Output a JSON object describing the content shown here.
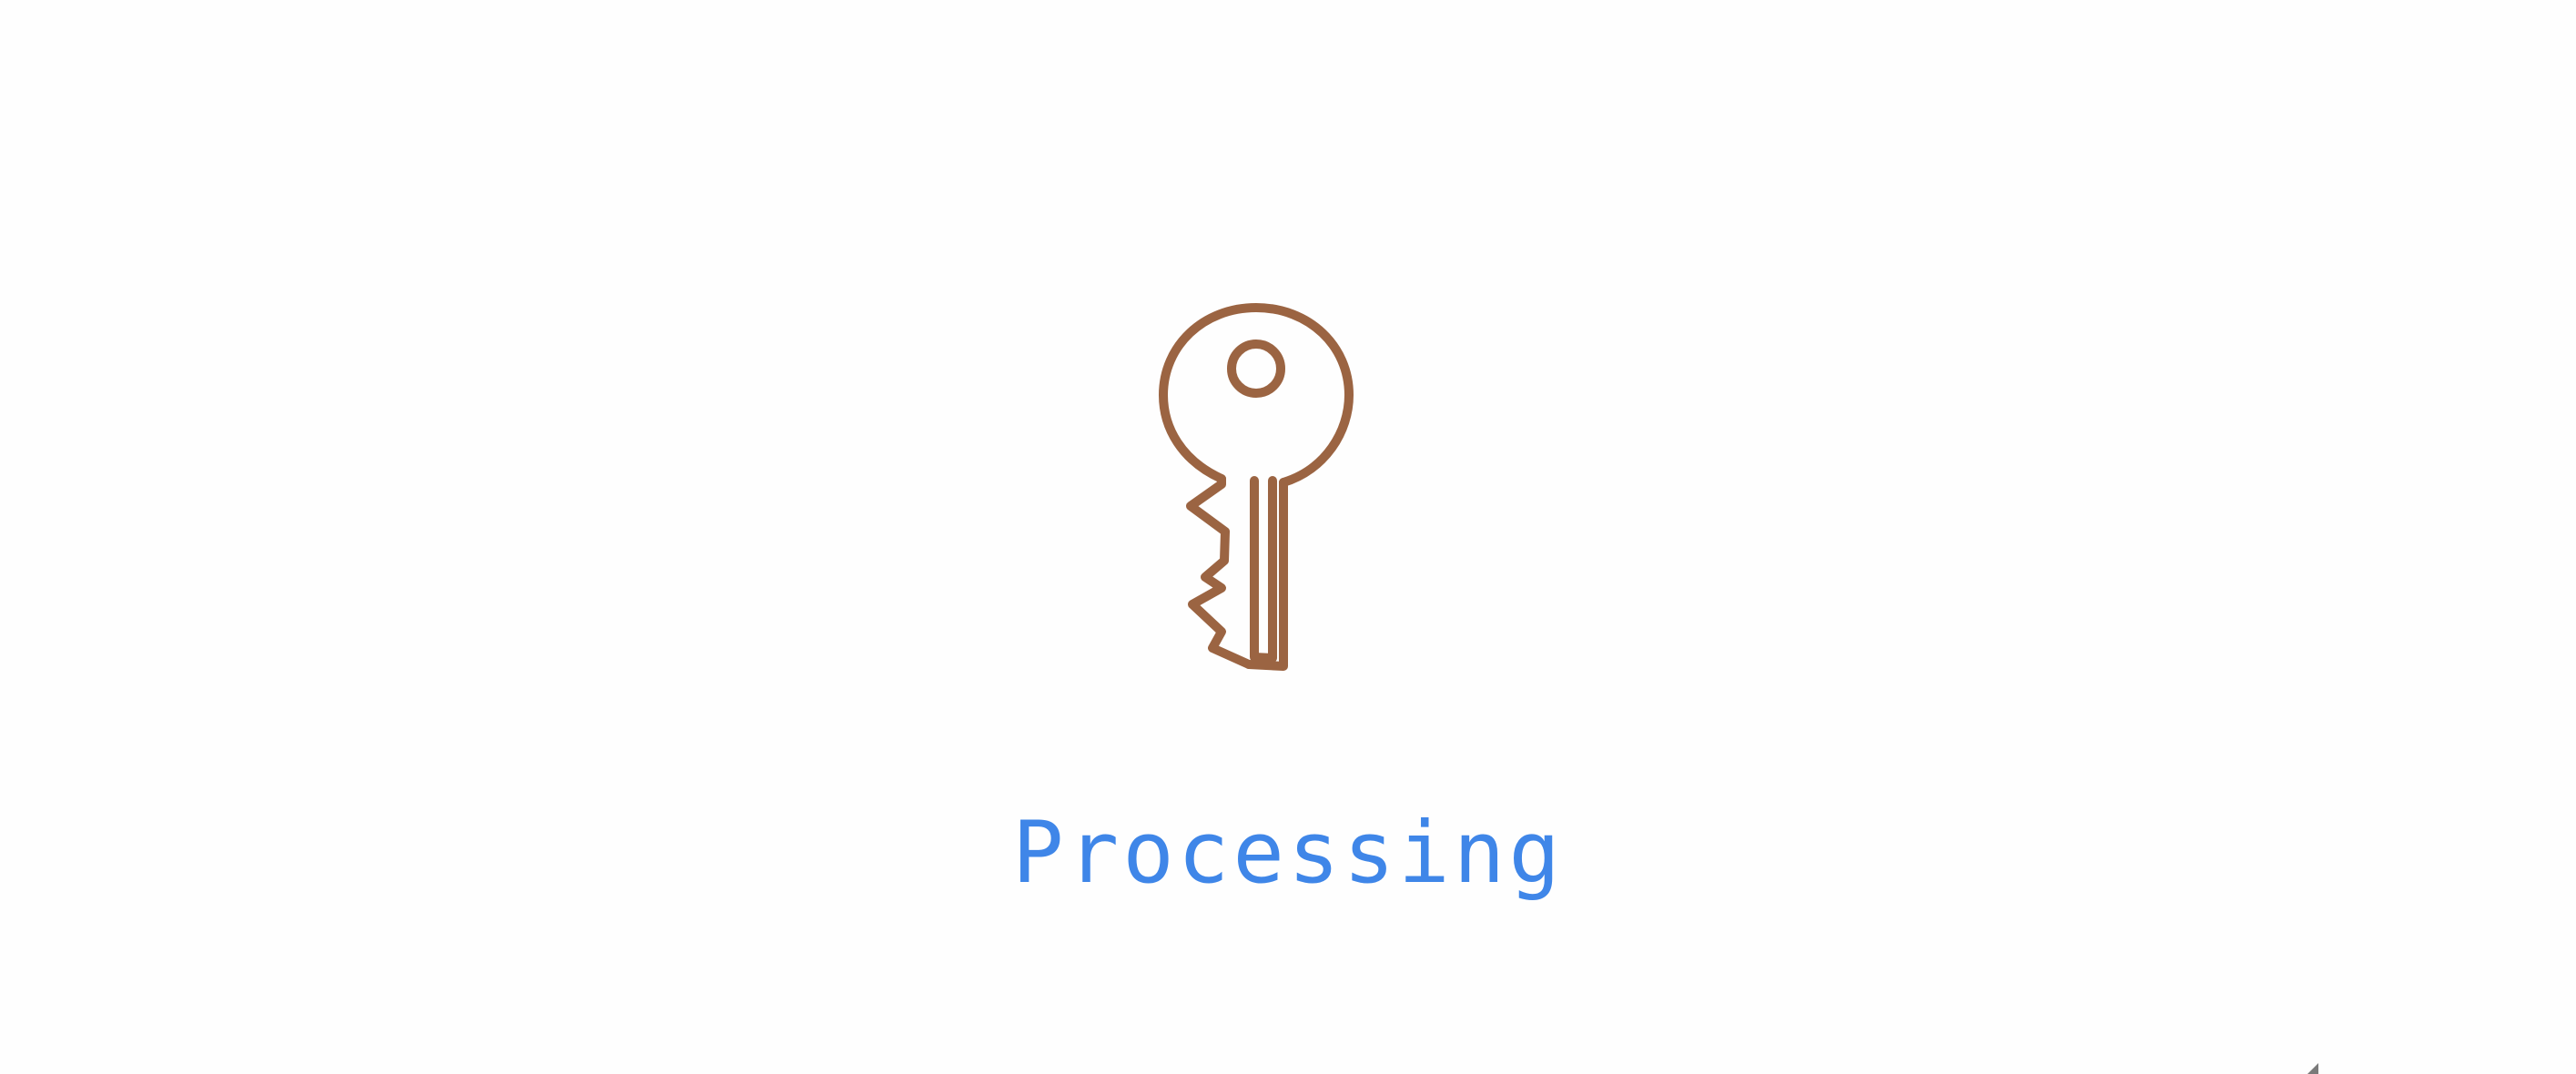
{
  "status": {
    "text": "Processing",
    "color": "#3f86e8"
  },
  "icon": {
    "name": "key-icon",
    "color": "#9b6442"
  },
  "corner": {
    "name": "resize-grip-icon"
  }
}
